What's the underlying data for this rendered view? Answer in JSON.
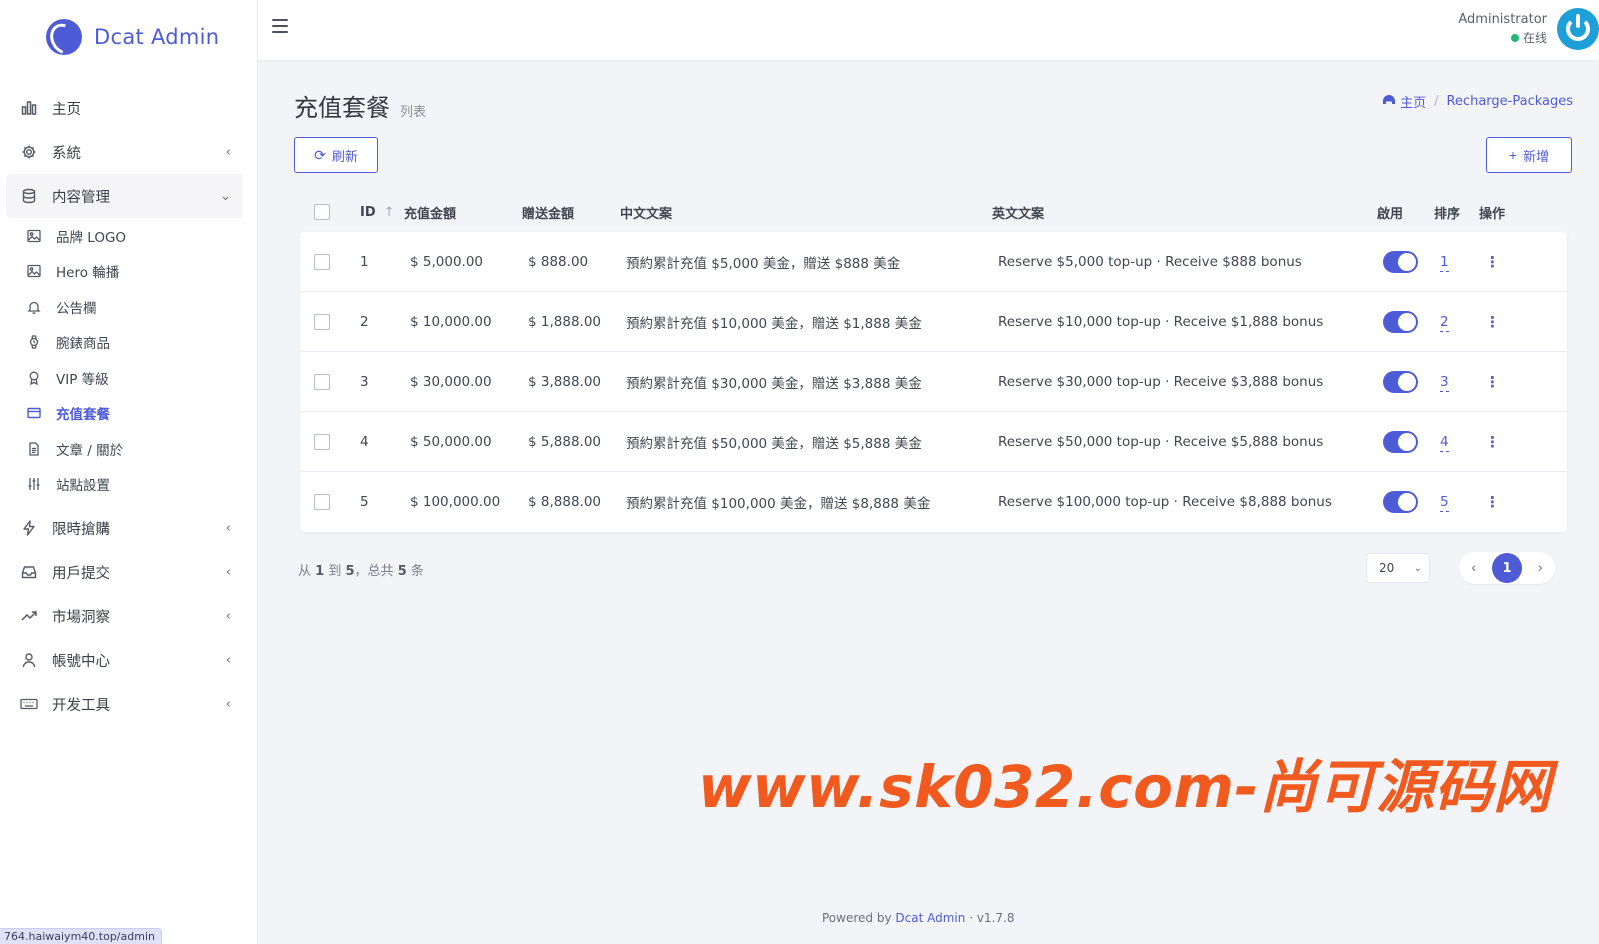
{
  "brand": {
    "name": "Dcat Admin"
  },
  "sidebar": {
    "items": [
      {
        "label": "主页",
        "icon": "bar-chart-icon"
      },
      {
        "label": "系統",
        "icon": "gear-icon"
      },
      {
        "label": "内容管理",
        "icon": "database-icon"
      },
      {
        "label": "限時搶購",
        "icon": "bolt-icon"
      },
      {
        "label": "用戶提交",
        "icon": "inbox-icon"
      },
      {
        "label": "市場洞察",
        "icon": "trend-icon"
      },
      {
        "label": "帳號中心",
        "icon": "user-icon"
      },
      {
        "label": "开发工具",
        "icon": "keyboard-icon"
      }
    ],
    "sub_items": [
      {
        "label": "品牌 LOGO",
        "icon": "image-icon"
      },
      {
        "label": "Hero 輪播",
        "icon": "image-icon"
      },
      {
        "label": "公告欄",
        "icon": "bell-icon"
      },
      {
        "label": "腕錶商品",
        "icon": "watch-icon"
      },
      {
        "label": "VIP 等級",
        "icon": "award-icon"
      },
      {
        "label": "充值套餐",
        "icon": "card-icon"
      },
      {
        "label": "文章 / 關於",
        "icon": "file-icon"
      },
      {
        "label": "站點設置",
        "icon": "sliders-icon"
      }
    ],
    "status_url": "764.haiwaiym40.top/admin"
  },
  "topbar": {
    "user_name": "Administrator",
    "user_status": "在线"
  },
  "page": {
    "title": "充值套餐",
    "subtitle": "列表",
    "breadcrumb_home": "主页",
    "breadcrumb_current": "Recharge-Packages",
    "refresh_label": "刷新",
    "add_label": "新增"
  },
  "table": {
    "headers": {
      "id": "ID",
      "amount": "充值金額",
      "bonus": "贈送金額",
      "cn": "中文文案",
      "en": "英文文案",
      "enabled": "啟用",
      "sort": "排序",
      "op": "操作"
    },
    "rows": [
      {
        "id": "1",
        "amount": "$ 5,000.00",
        "bonus": "$ 888.00",
        "cn": "預約累計充值 $5,000 美金，贈送 $888 美金",
        "en": "Reserve $5,000 top-up · Receive $888 bonus",
        "sort": "1"
      },
      {
        "id": "2",
        "amount": "$ 10,000.00",
        "bonus": "$ 1,888.00",
        "cn": "預約累計充值 $10,000 美金，贈送 $1,888 美金",
        "en": "Reserve $10,000 top-up · Receive $1,888 bonus",
        "sort": "2"
      },
      {
        "id": "3",
        "amount": "$ 30,000.00",
        "bonus": "$ 3,888.00",
        "cn": "預約累計充值 $30,000 美金，贈送 $3,888 美金",
        "en": "Reserve $30,000 top-up · Receive $3,888 bonus",
        "sort": "3"
      },
      {
        "id": "4",
        "amount": "$ 50,000.00",
        "bonus": "$ 5,888.00",
        "cn": "預約累計充值 $50,000 美金，贈送 $5,888 美金",
        "en": "Reserve $50,000 top-up · Receive $5,888 bonus",
        "sort": "4"
      },
      {
        "id": "5",
        "amount": "$ 100,000.00",
        "bonus": "$ 8,888.00",
        "cn": "預約累計充值 $100,000 美金，贈送 $8,888 美金",
        "en": "Reserve $100,000 top-up · Receive $8,888 bonus",
        "sort": "5"
      }
    ]
  },
  "pagination": {
    "info_from_label": "从",
    "from": "1",
    "to_label": "到",
    "to": "5",
    "total_label": "，总共",
    "total": "5",
    "unit": "条",
    "per_page": "20",
    "current_page": "1"
  },
  "footer": {
    "powered_by": "Powered by",
    "product": "Dcat Admin",
    "version": "v1.7.8"
  },
  "watermark": "www.sk032.com-尚可源码网",
  "colors": {
    "primary": "#4e5bd6",
    "online": "#21b978",
    "watermark": "#f05a1e"
  }
}
